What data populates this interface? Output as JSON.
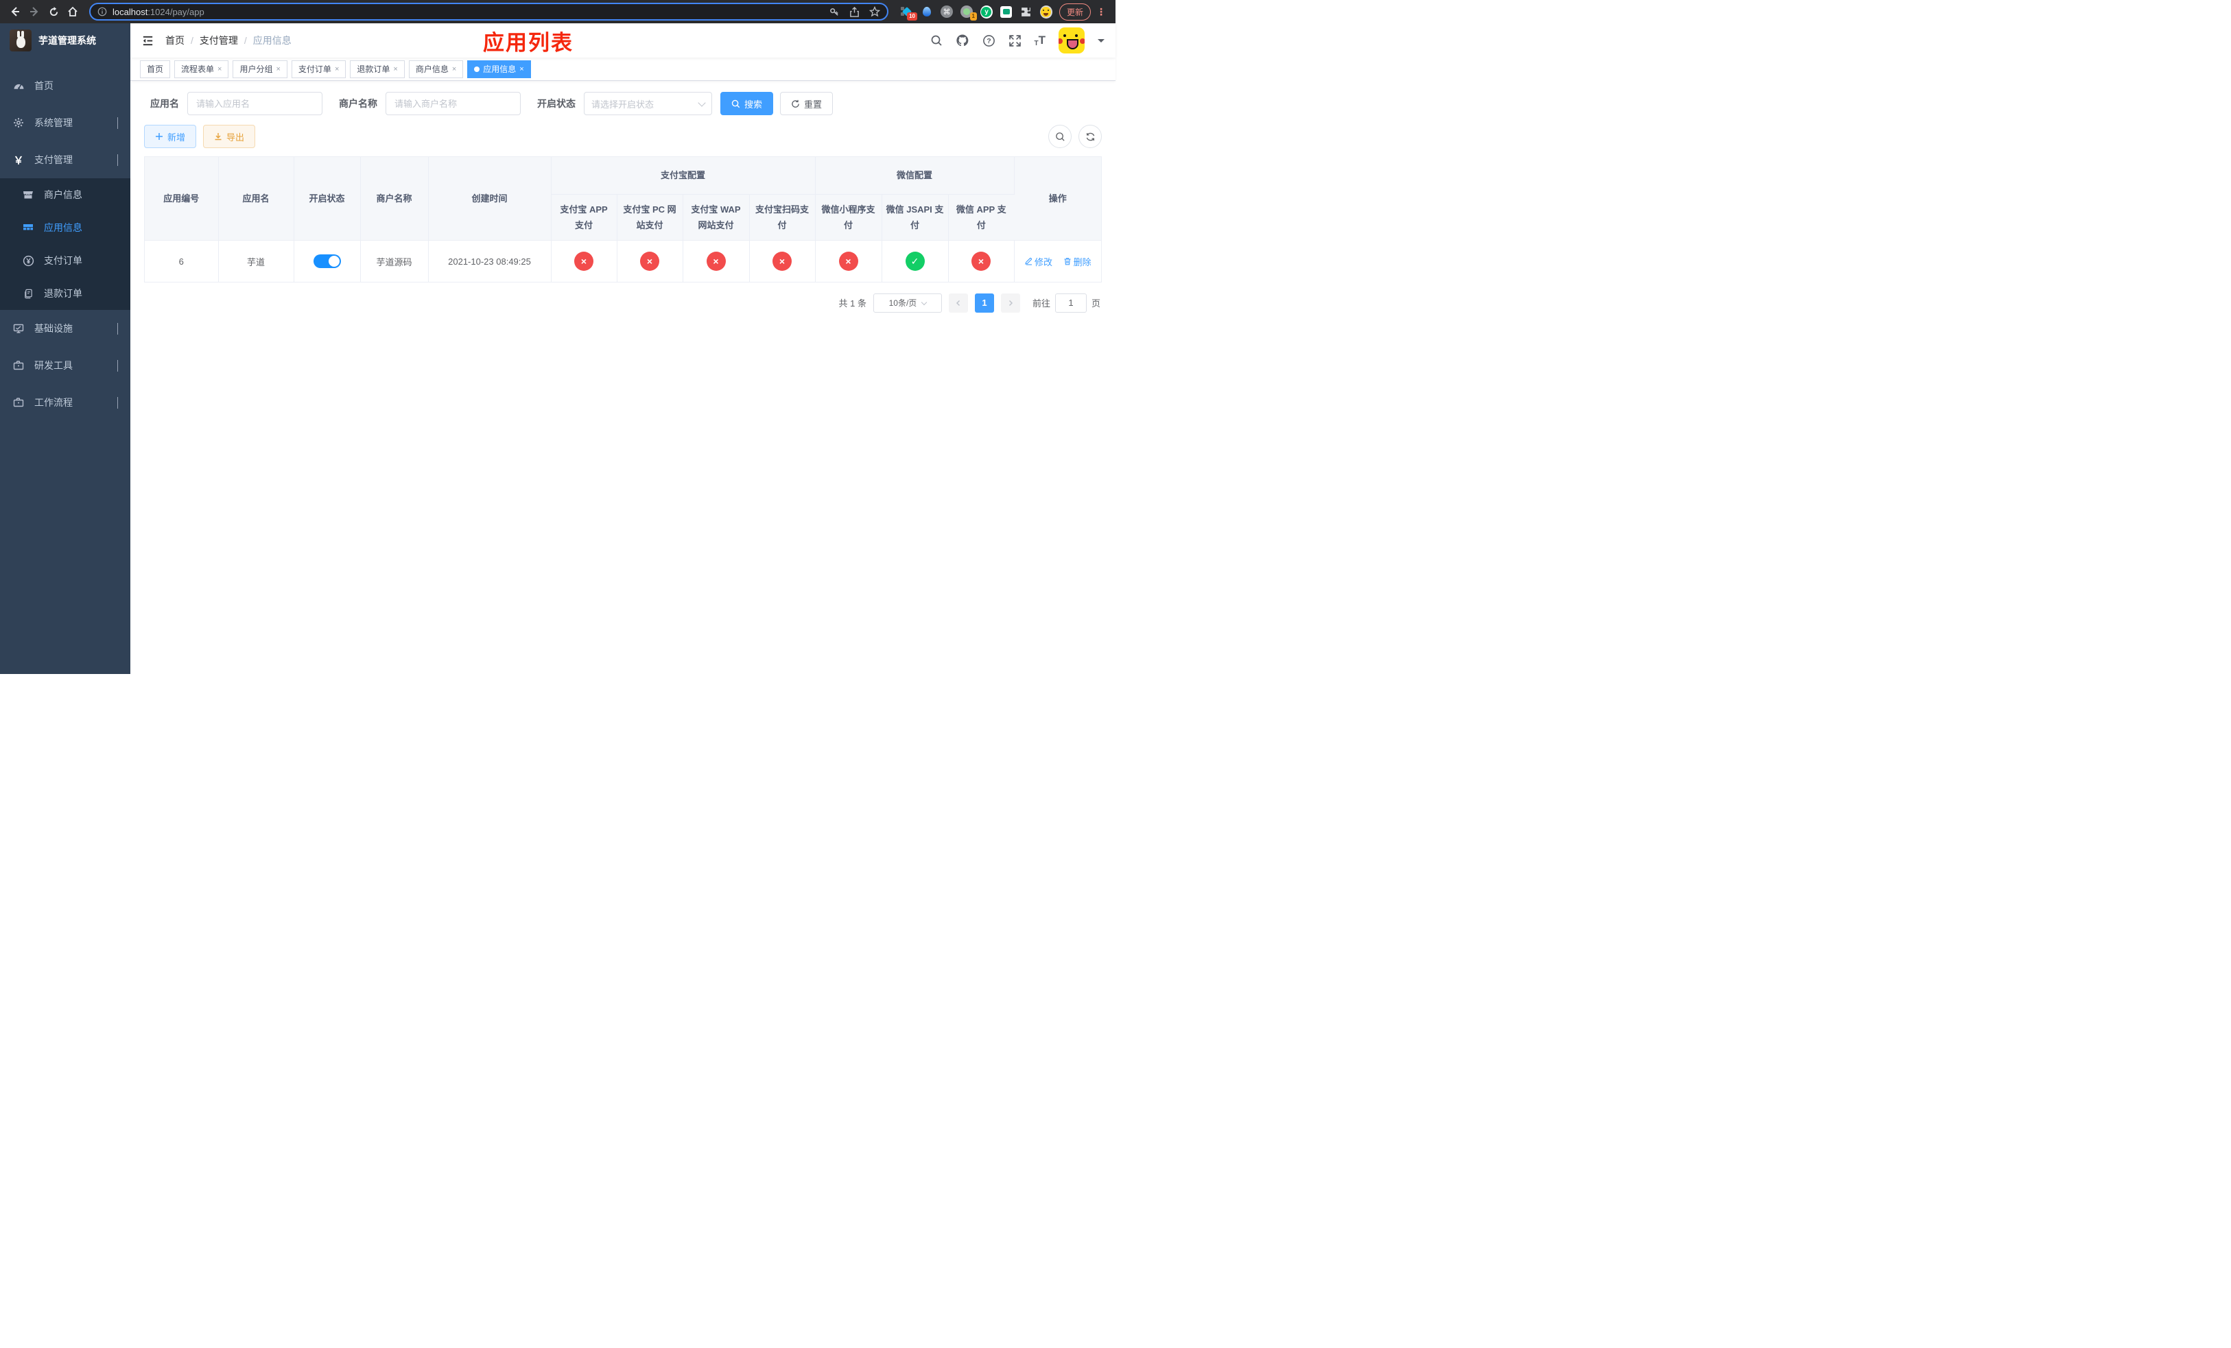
{
  "colors": {
    "accent": "#409eff",
    "success": "#13ce66",
    "danger": "#f24c4c",
    "warning": "#e6a23c",
    "sidebar_bg": "#304156",
    "submenu_bg": "#1f2d3d",
    "annotation_red": "#f5270d"
  },
  "icons": {
    "close": "×",
    "check": "✓",
    "cross": "×",
    "yen": "￥",
    "info": "i",
    "question": "?",
    "command": "⌘"
  },
  "browser": {
    "url_host": "localhost",
    "url_rest": ":1024/pay/app",
    "update_button": "更新",
    "ext_badge_a": "10",
    "ext_badge_b": "1"
  },
  "sidebar": {
    "title": "芋道管理系统",
    "items": [
      {
        "label": "首页"
      },
      {
        "label": "系统管理"
      },
      {
        "label": "支付管理"
      },
      {
        "label": "基础设施"
      },
      {
        "label": "研发工具"
      },
      {
        "label": "工作流程"
      }
    ],
    "payment_submenu": [
      {
        "label": "商户信息"
      },
      {
        "label": "应用信息"
      },
      {
        "label": "支付订单"
      },
      {
        "label": "退款订单"
      }
    ]
  },
  "header": {
    "breadcrumb": [
      "首页",
      "支付管理",
      "应用信息"
    ],
    "separator": "/",
    "annotation": "应用列表"
  },
  "tabs": [
    {
      "label": "首页"
    },
    {
      "label": "流程表单"
    },
    {
      "label": "用户分组"
    },
    {
      "label": "支付订单"
    },
    {
      "label": "退款订单"
    },
    {
      "label": "商户信息"
    },
    {
      "label": "应用信息"
    }
  ],
  "filters": {
    "app_name_label": "应用名",
    "app_name_placeholder": "请输入应用名",
    "merchant_label": "商户名称",
    "merchant_placeholder": "请输入商户名称",
    "status_label": "开启状态",
    "status_placeholder": "请选择开启状态",
    "search_button": "搜索",
    "reset_button": "重置"
  },
  "toolbar": {
    "add_button": "新增",
    "export_button": "导出"
  },
  "table": {
    "columns": [
      "应用编号",
      "应用名",
      "开启状态",
      "商户名称",
      "创建时间"
    ],
    "groups": [
      "支付宝配置",
      "微信配置"
    ],
    "sub_columns": [
      "支付宝 APP 支付",
      "支付宝 PC 网站支付",
      "支付宝 WAP 网站支付",
      "支付宝扫码支付",
      "微信小程序支付",
      "微信 JSAPI 支付",
      "微信 APP 支付"
    ],
    "ops_column": "操作",
    "rows": [
      {
        "id": "6",
        "name": "芋道",
        "enabled": true,
        "merchant": "芋道源码",
        "created_at": "2021-10-23 08:49:25",
        "configs": [
          false,
          false,
          false,
          false,
          false,
          true,
          false
        ],
        "edit_label": "修改",
        "delete_label": "删除"
      }
    ]
  },
  "pagination": {
    "total": "共 1 条",
    "page_size": "10条/页",
    "current_page": "1",
    "goto_label": "前往",
    "goto_value": "1",
    "page_unit": "页"
  }
}
